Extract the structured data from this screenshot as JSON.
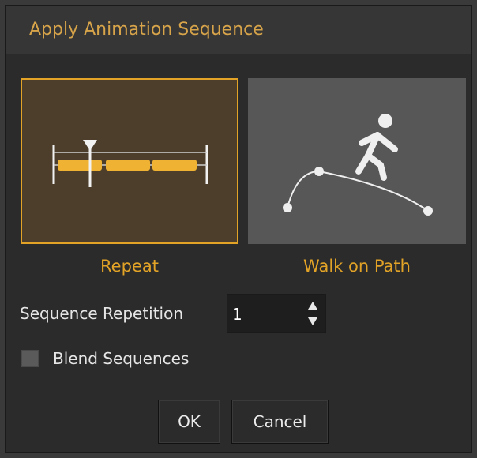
{
  "dialog": {
    "title": "Apply Animation Sequence"
  },
  "options": {
    "repeat_label": "Repeat",
    "walk_label": "Walk on Path",
    "selected": "Repeat"
  },
  "repetition": {
    "label": "Sequence Repetition",
    "value": "1"
  },
  "blend": {
    "label": "Blend Sequences",
    "checked": false
  },
  "buttons": {
    "ok": "OK",
    "cancel": "Cancel"
  },
  "colors": {
    "accent": "#e2a327",
    "title": "#d7a44a"
  }
}
